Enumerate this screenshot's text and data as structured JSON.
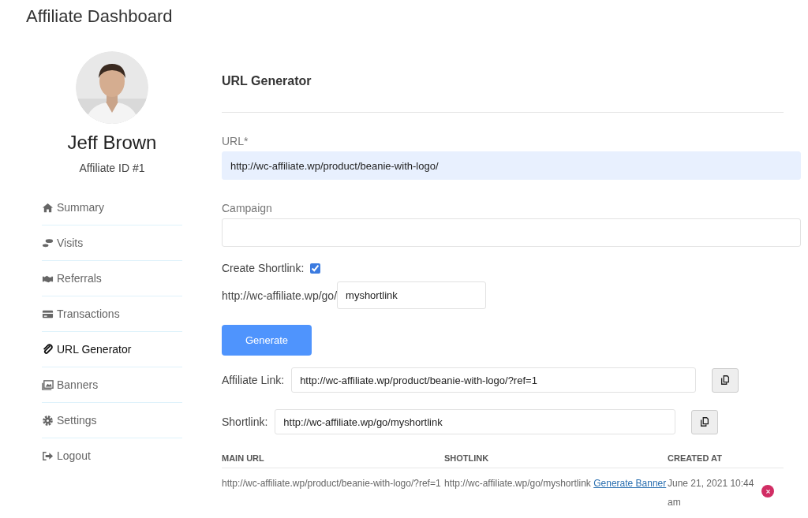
{
  "page_title": "Affiliate Dashboard",
  "profile": {
    "name": "Jeff Brown",
    "affiliate_id": "Affiliate ID #1"
  },
  "sidebar": {
    "items": [
      {
        "label": "Summary",
        "selected": false
      },
      {
        "label": "Visits",
        "selected": false
      },
      {
        "label": "Referrals",
        "selected": false
      },
      {
        "label": "Transactions",
        "selected": false
      },
      {
        "label": "URL Generator",
        "selected": true
      },
      {
        "label": "Banners",
        "selected": false
      },
      {
        "label": "Settings",
        "selected": false
      },
      {
        "label": "Logout",
        "selected": false
      }
    ]
  },
  "section_title": "URL Generator",
  "url_field": {
    "label": "URL*",
    "value": "http://wc-affiliate.wp/product/beanie-with-logo/"
  },
  "campaign_field": {
    "label": "Campaign"
  },
  "create_shortlink": {
    "label": "Create Shortlink:",
    "checked": true
  },
  "shortlink_prefix": "http://wc-affiliate.wp/go/",
  "shortlink_value": "myshortlink",
  "generate_button": "Generate",
  "affiliate_link": {
    "label": "Affiliate Link:",
    "value": "http://wc-affiliate.wp/product/beanie-with-logo/?ref=1"
  },
  "shortlink": {
    "label": "Shortlink:",
    "value": "http://wc-affiliate.wp/go/myshortlink"
  },
  "table": {
    "columns": [
      "MAIN URL",
      "SHOTLINK",
      "CREATED AT"
    ],
    "rows": [
      {
        "main_url": "http://wc-affiliate.wp/product/beanie-with-logo/?ref=1",
        "shortlink": "http://wc-affiliate.wp/go/myshortlink",
        "link": "Generate Banner",
        "created_at": "June 21, 2021 10:44 am"
      }
    ]
  }
}
